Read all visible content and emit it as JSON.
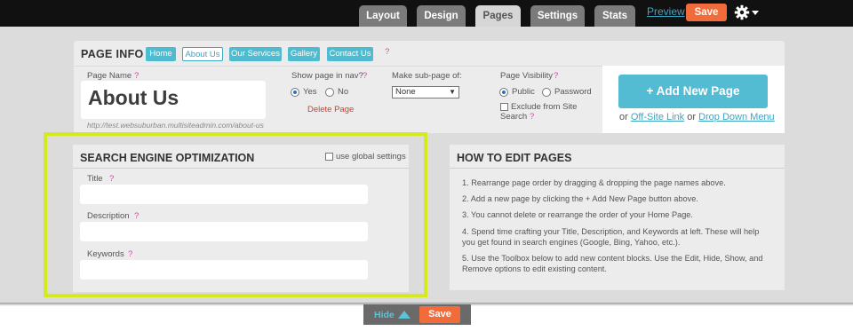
{
  "topbar": {
    "tabs": [
      {
        "label": "Layout"
      },
      {
        "label": "Design"
      },
      {
        "label": "Pages"
      },
      {
        "label": "Settings"
      },
      {
        "label": "Stats"
      }
    ],
    "preview_label": "Preview",
    "save_label": "Save",
    "gear_icon": "gear-icon"
  },
  "page_info": {
    "title": "PAGE INFO",
    "page_buttons": [
      "Home",
      "About Us",
      "Our Services",
      "Gallery",
      "Contact Us"
    ],
    "active_page": "About Us",
    "help_mark": "?",
    "page_name_label": "Page Name",
    "page_name_help": "?",
    "page_name_value": "About Us",
    "url": "http://test.websuburban.multisiteadmin.com/about-us",
    "show_in_nav_label": "Show page in nav?",
    "show_in_nav_help": "?",
    "yes_label": "Yes",
    "no_label": "No",
    "show_in_nav_selected": "Yes",
    "delete_page_label": "Delete Page",
    "subpage_label": "Make sub-page of:",
    "subpage_value": "None",
    "visibility_label": "Page Visibility",
    "visibility_help": "?",
    "public_label": "Public",
    "password_label": "Password",
    "visibility_selected": "Public",
    "exclude_label_1": "Exclude from Site",
    "exclude_label_2": "Search",
    "exclude_help": "?",
    "exclude_checked": false
  },
  "add_page": {
    "button_label": "+ Add New Page",
    "or_1": "or",
    "offsite_link": "Off-Site Link",
    "or_2": "or",
    "dropdown_link": "Drop Down Menu"
  },
  "seo": {
    "title": "SEARCH ENGINE OPTIMIZATION",
    "global_label": "use global settings",
    "global_checked": false,
    "fields": [
      {
        "label": "Title",
        "help": "?",
        "value": ""
      },
      {
        "label": "Description",
        "help": "?",
        "value": ""
      },
      {
        "label": "Keywords",
        "help": "?",
        "value": ""
      }
    ]
  },
  "how_to": {
    "title": "HOW TO EDIT PAGES",
    "steps": [
      "1. Rearrange page order by dragging & dropping the page names above.",
      "2. Add a new page by clicking the + Add New Page button above.",
      "3. You cannot delete or rearrange the order of your Home Page.",
      "4. Spend time crafting your Title, Description, and Keywords at left. These will help you get found in search engines (Google, Bing, Yahoo, etc.).",
      "5. Use the Toolbox below to add new content blocks. Use the Edit, Hide, Show, and Remove options to edit existing content."
    ]
  },
  "bottom_bar": {
    "hide_label": "Hide",
    "save_label": "Save"
  },
  "colors": {
    "accent": "#4dbbd0",
    "save": "#f26b3a",
    "highlight": "#d5ea1e",
    "help": "#d04ba0"
  }
}
